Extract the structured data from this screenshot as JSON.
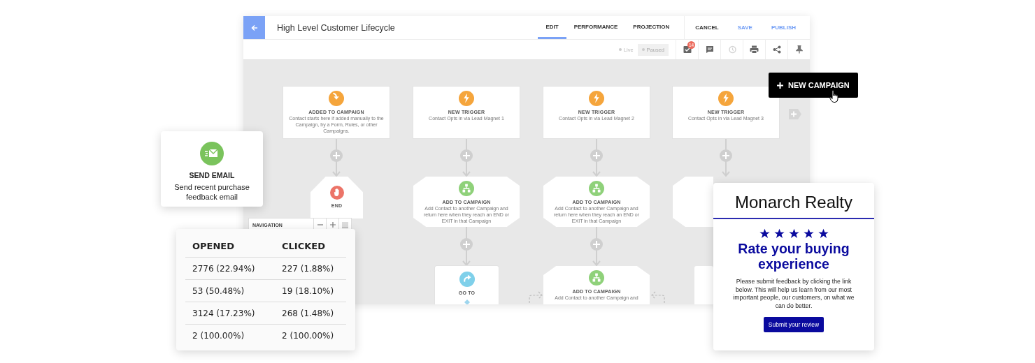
{
  "header": {
    "title": "High Level Customer Lifecycle",
    "tabs": [
      {
        "label": "EDIT",
        "selected": true
      },
      {
        "label": "PERFORMANCE",
        "selected": false
      },
      {
        "label": "PROJECTION",
        "selected": false
      }
    ],
    "actions": [
      {
        "label": "CANCEL",
        "kind": "neutral"
      },
      {
        "label": "SAVE",
        "kind": "primary"
      },
      {
        "label": "PUBLISH",
        "kind": "primary"
      }
    ]
  },
  "toolbar": {
    "status_toggle": [
      {
        "label": "Live",
        "selected": false
      },
      {
        "label": "Paused",
        "selected": true
      }
    ],
    "tasks_badge": "14"
  },
  "nodes": [
    {
      "kind": "start",
      "title": "ADDED TO CAMPAIGN",
      "description": "Contact starts here if added manually to the Campaign, by a Form, Rules, or other Campaigns."
    },
    {
      "kind": "trigger",
      "title": "NEW TRIGGER",
      "description": "Contact Opts in via Lead Magnet 1"
    },
    {
      "kind": "trigger",
      "title": "NEW TRIGGER",
      "description": "Contact Opts in via Lead Magnet 2"
    },
    {
      "kind": "trigger",
      "title": "NEW TRIGGER",
      "description": "Contact Opts in via Lead Magnet 3"
    },
    {
      "kind": "end",
      "title": "END"
    },
    {
      "kind": "add",
      "title": "ADD TO CAMPAIGN",
      "description": "Add Contact to another Campaign and return here when they reach an END or EXIT in that Campaign"
    },
    {
      "kind": "add",
      "title": "ADD TO CAMPAIGN",
      "description": "Add Contact to another Campaign and return here when they reach an END or EXIT in that Campaign"
    },
    {
      "kind": "goto",
      "title": "GO TO"
    },
    {
      "kind": "add",
      "title": "ADD TO CAMPAIGN",
      "description": "Add Contact to another Campaign and"
    }
  ],
  "new_campaign_button": "NEW CAMPAIGN",
  "navigation": {
    "label": "NAVIGATION"
  },
  "send_email_card": {
    "title": "SEND EMAIL",
    "description": "Send recent purchase feedback email"
  },
  "stats_table": {
    "columns": [
      "OPENED",
      "CLICKED"
    ],
    "rows": [
      [
        "2776 (22.94%)",
        "227 (1.88%)"
      ],
      [
        "53 (50.48%)",
        "19 (18.10%)"
      ],
      [
        "3124 (17.23%)",
        "268 (1.48%)"
      ],
      [
        "2 (100.00%)",
        "2 (100.00%)"
      ]
    ]
  },
  "email_preview": {
    "brand": "Monarch Realty",
    "stars": 5,
    "heading": "Rate your buying experience",
    "body": "Please submit feedback by clicking the link below. This will help us learn from our most important people, our customers, on what we can do better.",
    "button": "Submit your review"
  }
}
